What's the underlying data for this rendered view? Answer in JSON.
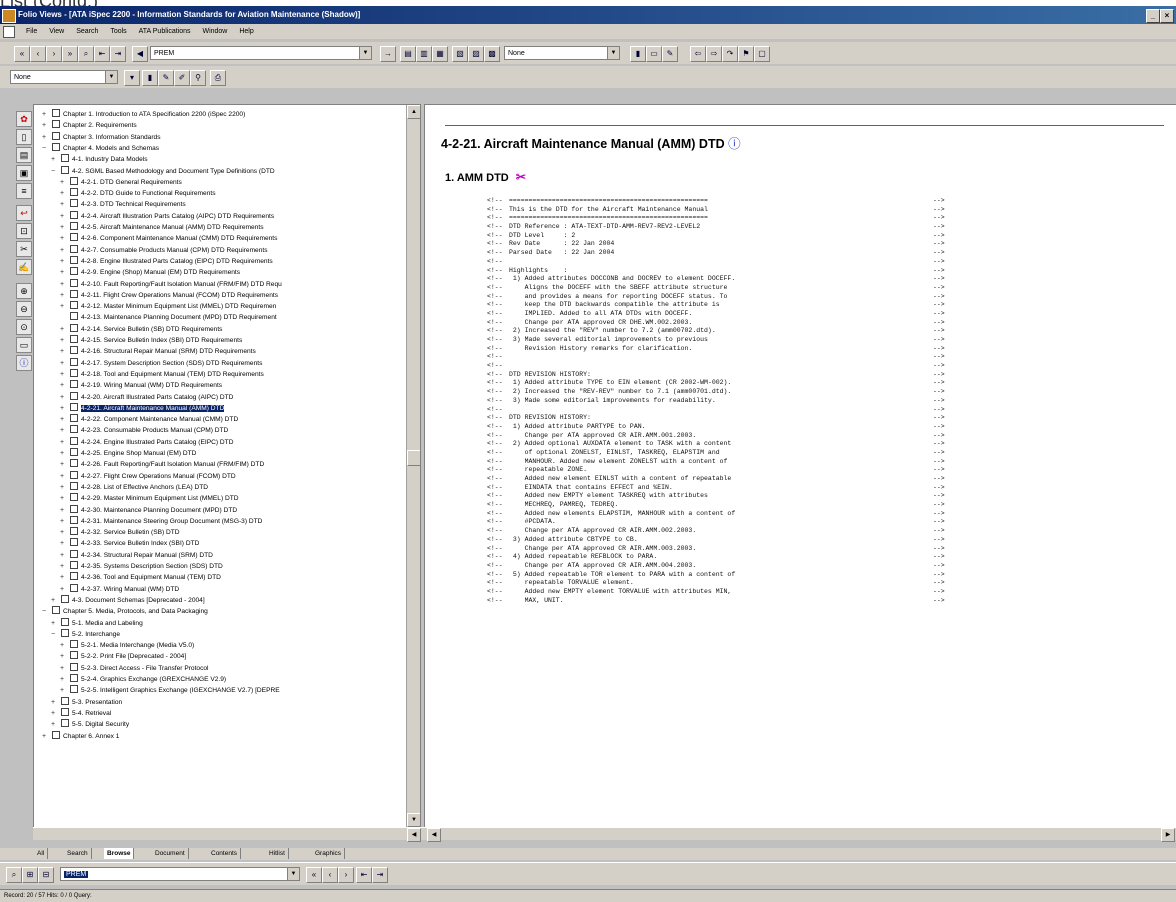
{
  "slide_fragment": "List (Contd.)",
  "window": {
    "title": "Folio Views - [ATA iSpec 2200 - Information Standards for Aviation Maintenance (Shadow)]"
  },
  "menu": [
    "File",
    "View",
    "Search",
    "Tools",
    "ATA Publications",
    "Window",
    "Help"
  ],
  "toolbar": {
    "field_combo_value": "PREM",
    "style_combo_value": "None",
    "highlight_combo_value": "None"
  },
  "tree": {
    "items": [
      {
        "label": "Chapter 1. Introduction to ATA Specification 2200 (iSpec 2200)",
        "indent": 0,
        "pm": "+"
      },
      {
        "label": "Chapter 2. Requirements",
        "indent": 0,
        "pm": "+"
      },
      {
        "label": "Chapter 3. Information Standards",
        "indent": 0,
        "pm": "+"
      },
      {
        "label": "Chapter 4. Models and Schemas",
        "indent": 0,
        "pm": "−"
      },
      {
        "label": "4-1. Industry Data Models",
        "indent": 1,
        "pm": "+"
      },
      {
        "label": "4-2. SGML Based Methodology and Document Type Definitions (DTD",
        "indent": 1,
        "pm": "−"
      },
      {
        "label": "4-2-1. DTD General Requirements",
        "indent": 2,
        "pm": "+"
      },
      {
        "label": "4-2-2. DTD Guide to Functional Requirements",
        "indent": 2,
        "pm": "+"
      },
      {
        "label": "4-2-3. DTD Technical Requirements",
        "indent": 2,
        "pm": "+"
      },
      {
        "label": "4-2-4. Aircraft Illustration Parts Catalog (AIPC) DTD Requirements",
        "indent": 2,
        "pm": "+"
      },
      {
        "label": "4-2-5. Aircraft Maintenance Manual (AMM) DTD Requirements",
        "indent": 2,
        "pm": "+"
      },
      {
        "label": "4-2-6. Component Maintenance Manual (CMM) DTD Requirements",
        "indent": 2,
        "pm": "+"
      },
      {
        "label": "4-2-7. Consumable Products Manual (CPM) DTD Requirements",
        "indent": 2,
        "pm": "+"
      },
      {
        "label": "4-2-8. Engine Illustrated Parts Catalog (EIPC) DTD Requirements",
        "indent": 2,
        "pm": "+"
      },
      {
        "label": "4-2-9. Engine (Shop) Manual (EM) DTD Requirements",
        "indent": 2,
        "pm": "+"
      },
      {
        "label": "4-2-10. Fault Reporting/Fault Isolation Manual (FRM/FIM) DTD Requ",
        "indent": 2,
        "pm": "+"
      },
      {
        "label": "4-2-11. Flight Crew Operations Manual (FCOM) DTD Requirements",
        "indent": 2,
        "pm": "+"
      },
      {
        "label": "4-2-12. Master Minimum Equipment List (MMEL) DTD Requiremen",
        "indent": 2,
        "pm": "+"
      },
      {
        "label": "4-2-13. Maintenance Planning Document (MPD) DTD Requirement",
        "indent": 2,
        "pm": ""
      },
      {
        "label": "4-2-14. Service Bulletin (SB) DTD Requirements",
        "indent": 2,
        "pm": "+"
      },
      {
        "label": "4-2-15. Service Bulletin Index (SBI) DTD Requirements",
        "indent": 2,
        "pm": "+"
      },
      {
        "label": "4-2-16. Structural Repair Manual (SRM) DTD Requirements",
        "indent": 2,
        "pm": "+"
      },
      {
        "label": "4-2-17. System Description Section (SDS) DTD Requirements",
        "indent": 2,
        "pm": "+"
      },
      {
        "label": "4-2-18. Tool and Equipment Manual (TEM) DTD Requirements",
        "indent": 2,
        "pm": "+"
      },
      {
        "label": "4-2-19. Wiring Manual (WM) DTD Requirements",
        "indent": 2,
        "pm": "+"
      },
      {
        "label": "4-2-20. Aircraft Illustrated Parts Catalog (AIPC) DTD",
        "indent": 2,
        "pm": "+"
      },
      {
        "label": "4-2-21. Aircraft Maintenance Manual (AMM) DTD",
        "indent": 2,
        "pm": "+",
        "selected": true
      },
      {
        "label": "4-2-22. Component Maintenance Manual (CMM) DTD",
        "indent": 2,
        "pm": "+"
      },
      {
        "label": "4-2-23. Consumable Products Manual (CPM) DTD",
        "indent": 2,
        "pm": "+"
      },
      {
        "label": "4-2-24. Engine Illustrated Parts Catalog (EIPC) DTD",
        "indent": 2,
        "pm": "+"
      },
      {
        "label": "4-2-25. Engine Shop Manual (EM) DTD",
        "indent": 2,
        "pm": "+"
      },
      {
        "label": "4-2-26. Fault Reporting/Fault Isolation Manual (FRM/FIM) DTD",
        "indent": 2,
        "pm": "+"
      },
      {
        "label": "4-2-27. Flight Crew Operations Manual (FCOM) DTD",
        "indent": 2,
        "pm": "+"
      },
      {
        "label": "4-2-28. List of Effective Anchors (LEA) DTD",
        "indent": 2,
        "pm": "+"
      },
      {
        "label": "4-2-29. Master Minimum Equipment List (MMEL) DTD",
        "indent": 2,
        "pm": "+"
      },
      {
        "label": "4-2-30. Maintenance Planning Document (MPD) DTD",
        "indent": 2,
        "pm": "+"
      },
      {
        "label": "4-2-31. Maintenance Steering Group Document (MSG-3) DTD",
        "indent": 2,
        "pm": "+"
      },
      {
        "label": "4-2-32. Service Bulletin (SB) DTD",
        "indent": 2,
        "pm": "+"
      },
      {
        "label": "4-2-33. Service Bulletin Index (SBI) DTD",
        "indent": 2,
        "pm": "+"
      },
      {
        "label": "4-2-34. Structural Repair Manual (SRM) DTD",
        "indent": 2,
        "pm": "+"
      },
      {
        "label": "4-2-35. Systems Description Section (SDS) DTD",
        "indent": 2,
        "pm": "+"
      },
      {
        "label": "4-2-36. Tool and Equipment Manual (TEM) DTD",
        "indent": 2,
        "pm": "+"
      },
      {
        "label": "4-2-37. Wiring Manual (WM) DTD",
        "indent": 2,
        "pm": "+"
      },
      {
        "label": "4-3. Document Schemas [Deprecated - 2004]",
        "indent": 1,
        "pm": "+"
      },
      {
        "label": "Chapter 5. Media, Protocols, and Data Packaging",
        "indent": 0,
        "pm": "−"
      },
      {
        "label": "5-1. Media and Labeling",
        "indent": 1,
        "pm": "+"
      },
      {
        "label": "5-2. Interchange",
        "indent": 1,
        "pm": "−"
      },
      {
        "label": "5-2-1. Media Interchange (Media V5.0)",
        "indent": 2,
        "pm": "+"
      },
      {
        "label": "5-2-2. Print File [Deprecated - 2004]",
        "indent": 2,
        "pm": "+"
      },
      {
        "label": "5-2-3. Direct Access - File Transfer Protocol",
        "indent": 2,
        "pm": "+"
      },
      {
        "label": "5-2-4. Graphics Exchange (GREXCHANGE V2.9)",
        "indent": 2,
        "pm": "+"
      },
      {
        "label": "5-2-5. Intelligent Graphics Exchange (IGEXCHANGE V2.7) [DEPRE",
        "indent": 2,
        "pm": "+"
      },
      {
        "label": "5-3. Presentation",
        "indent": 1,
        "pm": "+"
      },
      {
        "label": "5-4. Retrieval",
        "indent": 1,
        "pm": "+"
      },
      {
        "label": "5-5. Digital Security",
        "indent": 1,
        "pm": "+"
      },
      {
        "label": "Chapter 6. Annex 1",
        "indent": 0,
        "pm": "+"
      }
    ]
  },
  "content": {
    "heading": "4-2-21. Aircraft Maintenance Manual (AMM) DTD",
    "info_glyph": "ⓘ",
    "subheading": "1. AMM DTD",
    "code_lines": [
      {
        "txt": "===================================================",
        "e": "-->"
      },
      {
        "txt": "This is the DTD for the Aircraft Maintenance Manual",
        "e": "-->"
      },
      {
        "txt": "===================================================",
        "e": "-->"
      },
      {
        "txt": "DTD Reference : ATA-TEXT-DTD-AMM-REV7-REV2-LEVEL2",
        "e": "-->"
      },
      {
        "txt": "DTD Level     : 2",
        "e": "-->"
      },
      {
        "txt": "Rev Date      : 22 Jan 2004",
        "e": "-->"
      },
      {
        "txt": "Parsed Date   : 22 Jan 2004",
        "e": "-->"
      },
      {
        "txt": "",
        "e": "-->"
      },
      {
        "txt": "Highlights    :",
        "e": "-->"
      },
      {
        "txt": " 1) Added attributes DOCCONB and DOCREV to element DOCEFF.",
        "e": "-->"
      },
      {
        "txt": "    Aligns the DOCEFF with the SBEFF attribute structure",
        "e": "-->"
      },
      {
        "txt": "    and provides a means for reporting DOCEFF status. To",
        "e": "-->"
      },
      {
        "txt": "    keep the DTD backwards compatible the attribute is",
        "e": "-->"
      },
      {
        "txt": "    IMPLIED. Added to all ATA DTDs with DOCEFF.",
        "e": "-->"
      },
      {
        "txt": "    Change per ATA approved CR DHE.WM.002.2003.",
        "e": "-->"
      },
      {
        "txt": " 2) Increased the \"REV\" number to 7.2 (amm00702.dtd).",
        "e": "-->"
      },
      {
        "txt": " 3) Made several editorial improvements to previous",
        "e": "-->"
      },
      {
        "txt": "    Revision History remarks for clarification.",
        "e": "-->"
      },
      {
        "txt": "",
        "e": "-->"
      },
      {
        "txt": "",
        "e": "-->"
      },
      {
        "txt": "DTD REVISION HISTORY:",
        "e": "-->"
      },
      {
        "txt": " 1) Added attribute TYPE to EIN element (CR 2002-WM-002).",
        "e": "-->"
      },
      {
        "txt": " 2) Increased the \"REV-REV\" number to 7.1 (amm00701.dtd).",
        "e": "-->"
      },
      {
        "txt": " 3) Made some editorial improvements for readability.",
        "e": "-->"
      },
      {
        "txt": "",
        "e": "-->"
      },
      {
        "txt": "DTD REVISION HISTORY:",
        "e": "-->"
      },
      {
        "txt": " 1) Added attribute PARTYPE to PAN.",
        "e": "-->"
      },
      {
        "txt": "    Change per ATA approved CR AIR.AMM.001.2003.",
        "e": "-->"
      },
      {
        "txt": " 2) Added optional AUXDATA element to TASK with a content",
        "e": "-->"
      },
      {
        "txt": "    of optional ZONELST, EINLST, TASKREQ, ELAPSTIM and",
        "e": "-->"
      },
      {
        "txt": "    MANHOUR. Added new element ZONELST with a content of",
        "e": "-->"
      },
      {
        "txt": "    repeatable ZONE.",
        "e": "-->"
      },
      {
        "txt": "    Added new element EINLST with a content of repeatable",
        "e": "-->"
      },
      {
        "txt": "    EINDATA that contains EFFECT and %EIN.",
        "e": "-->"
      },
      {
        "txt": "    Added new EMPTY element TASKREQ with attributes",
        "e": "-->"
      },
      {
        "txt": "    MECHREQ, PAMREQ, TEDREQ.",
        "e": "-->"
      },
      {
        "txt": "    Added new elements ELAPSTIM, MANHOUR with a content of",
        "e": "-->"
      },
      {
        "txt": "    #PCDATA.",
        "e": "-->"
      },
      {
        "txt": "    Change per ATA approved CR AIR.AMM.002.2003.",
        "e": "-->"
      },
      {
        "txt": " 3) Added attribute CBTYPE to CB.",
        "e": "-->"
      },
      {
        "txt": "    Change per ATA approved CR AIR.AMM.003.2003.",
        "e": "-->"
      },
      {
        "txt": " 4) Added repeatable REFBLOCK to PARA.",
        "e": "-->"
      },
      {
        "txt": "    Change per ATA approved CR AIR.AMM.004.2003.",
        "e": "-->"
      },
      {
        "txt": " 5) Added repeatable TOR element to PARA with a content of",
        "e": "-->"
      },
      {
        "txt": "    repeatable TORVALUE element.",
        "e": "-->"
      },
      {
        "txt": "    Added new EMPTY element TORVALUE with attributes MIN,",
        "e": "-->"
      },
      {
        "txt": "    MAX, UNIT.",
        "e": "-->"
      }
    ]
  },
  "tabs": [
    "All",
    "Search",
    "Browse",
    "Document",
    "Contents",
    "Hitlist",
    "Graphics"
  ],
  "query": {
    "value": "PREM"
  },
  "status": "Record: 20 / 57  Hits: 0 / 0  Query:"
}
